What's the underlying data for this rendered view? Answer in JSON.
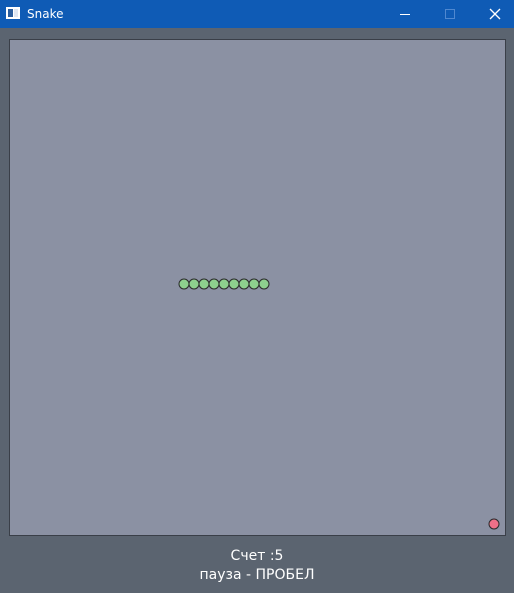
{
  "window": {
    "title": "Snake"
  },
  "game": {
    "snake_segments": 9,
    "food_count": 1,
    "colors": {
      "background": "#5b6470",
      "board": "#8b91a3",
      "snake": "#8ed08e",
      "food": "#f07088",
      "titlebar": "#0f5bb5"
    }
  },
  "status": {
    "score_text": "Счет :5",
    "pause_hint": "пауза - ПРОБЕЛ"
  }
}
